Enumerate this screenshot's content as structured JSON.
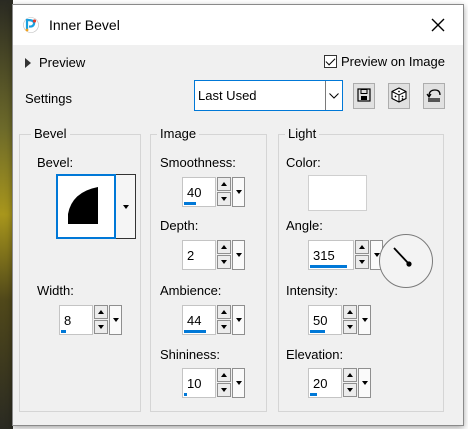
{
  "window": {
    "title": "Inner Bevel"
  },
  "preview": {
    "label": "Preview",
    "checkbox_label": "Preview on Image",
    "checked": true
  },
  "settings": {
    "label": "Settings",
    "preset": "Last Used"
  },
  "toolbar_icons": [
    "save-icon",
    "randomize-icon",
    "reset-icon"
  ],
  "groups": {
    "bevel": {
      "title": "Bevel",
      "bevel_label": "Bevel:",
      "width_label": "Width:",
      "width": "8",
      "width_level": 0.16
    },
    "image": {
      "title": "Image",
      "smoothness_label": "Smoothness:",
      "smoothness": "40",
      "smoothness_level": 0.4,
      "depth_label": "Depth:",
      "depth": "2",
      "depth_level": 0.0,
      "ambience_label": "Ambience:",
      "ambience": "44",
      "ambience_level": 0.72,
      "shininess_label": "Shininess:",
      "shininess": "10",
      "shininess_level": 0.1
    },
    "light": {
      "title": "Light",
      "color_label": "Color:",
      "color": "#ffffff",
      "angle_label": "Angle:",
      "angle": "315",
      "angle_level": 0.875,
      "intensity_label": "Intensity:",
      "intensity": "50",
      "intensity_level": 0.5,
      "elevation_label": "Elevation:",
      "elevation": "20",
      "elevation_level": 0.22
    }
  },
  "colors": {
    "accent": "#0078d7"
  }
}
